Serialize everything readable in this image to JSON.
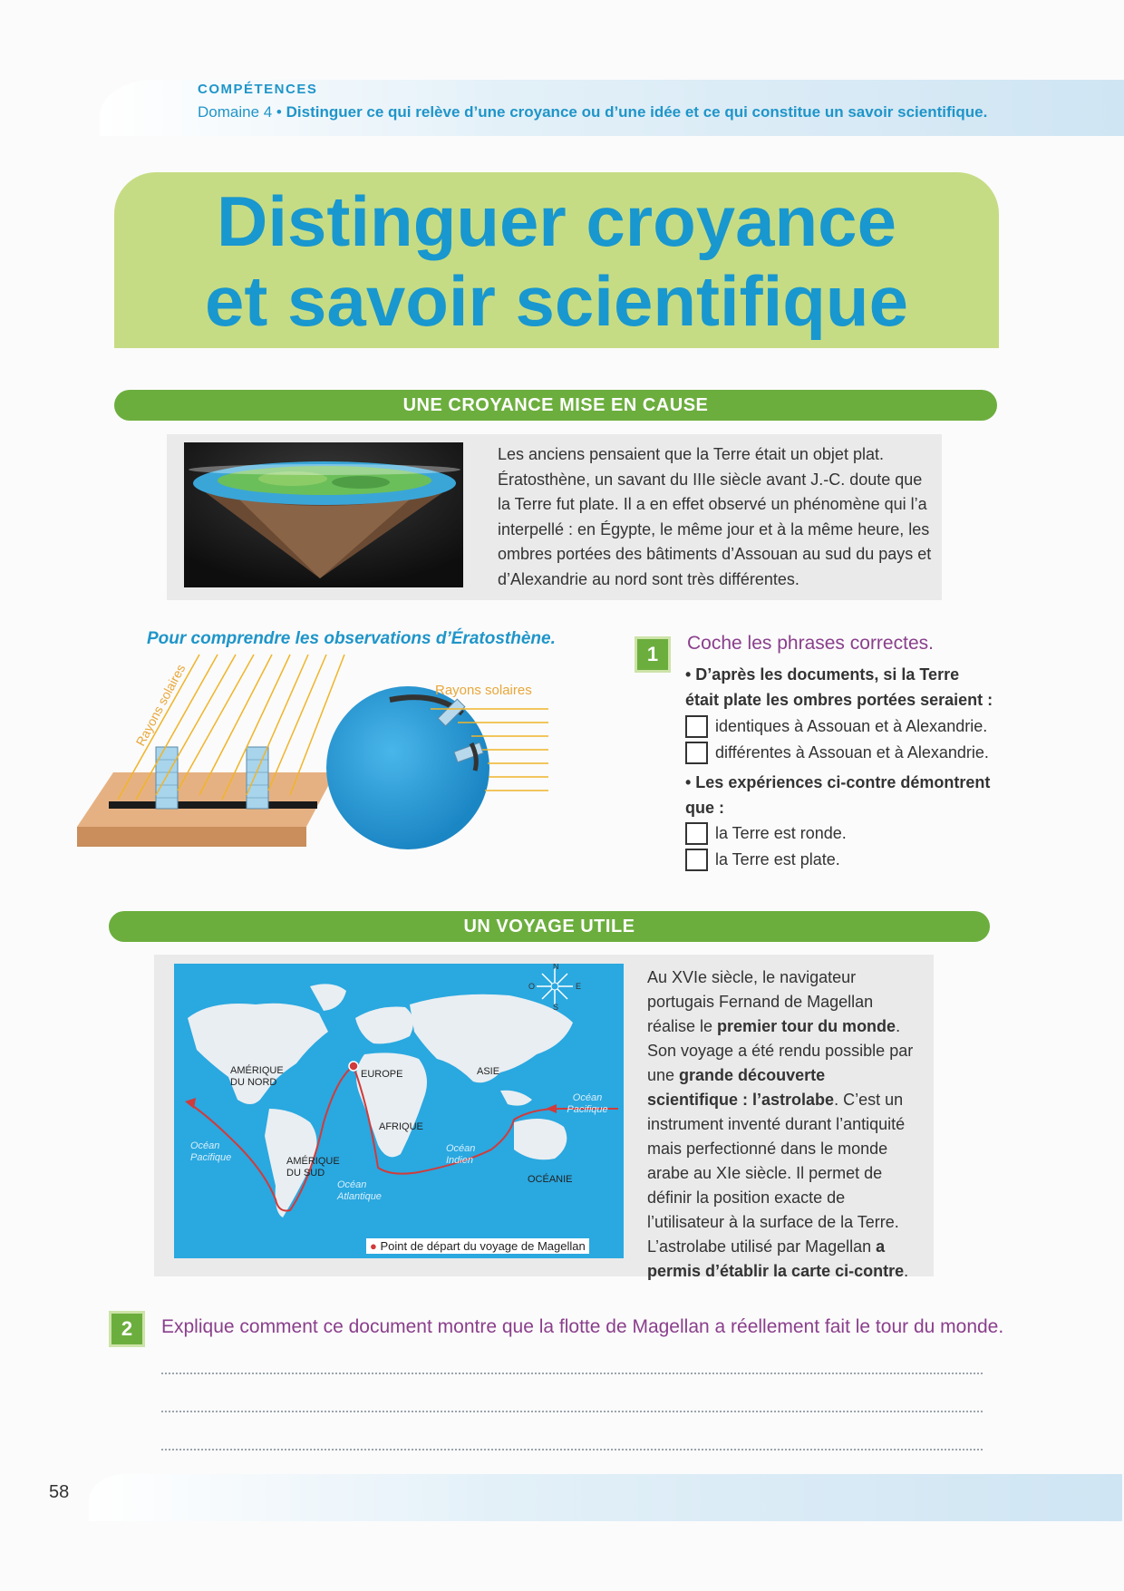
{
  "header": {
    "competences_label": "COMPÉTENCES",
    "domain_label": "Domaine 4 •",
    "domain_text": "Distinguer ce qui relève d’une croyance ou d’une idée et ce qui constitue un savoir scientifique."
  },
  "title": {
    "line1": "Distinguer croyance",
    "line2": "et savoir scientifique"
  },
  "section1": {
    "bar_label": "UNE CROYANCE MISE EN CAUSE",
    "text": "Les anciens pensaient que la Terre était un objet plat. Ératosthène, un savant du IIIe siècle avant J.-C. doute que la Terre fut plate. Il a en effet observé un phénomène qui l’a interpellé : en Égypte, le même jour et à la même heure, les ombres portées des bâtiments d’Assouan au sud du pays et d’Alexandrie au nord sont très différentes.",
    "caption": "Pour comprendre les observations d’Ératosthène.",
    "rays_label_left": "Rayons solaires",
    "rays_label_right": "Rayons solaires"
  },
  "exercise1": {
    "number": "1",
    "title": "Coche les phrases correctes.",
    "q1": "• D’après les documents, si la Terre était plate les ombres portées seraient :",
    "q1_options": [
      "identiques à Assouan et à Alexandrie.",
      "différentes à Assouan et à Alexandrie."
    ],
    "q2": "• Les expériences ci-contre démontrent que :",
    "q2_options": [
      "la Terre est ronde.",
      "la Terre est plate."
    ]
  },
  "section2": {
    "bar_label": "UN VOYAGE UTILE",
    "text_p1": "Au XVIe siècle, le navigateur portugais Fernand de Magellan réalise le ",
    "text_b1": "premier tour du monde",
    "text_p2": ". Son voyage a été rendu possible par une ",
    "text_b2": "grande découverte scientifique : l’astrolabe",
    "text_p3": ". C’est un instrument inventé durant l’antiquité mais perfectionné dans le monde arabe au XIe siècle. Il permet de définir la position exacte de l’utilisateur à la surface de la Terre. L’astrolabe utilisé par Magellan ",
    "text_b3": "a permis d’établir la carte ci-contre",
    "text_p4": ".",
    "map": {
      "north_america": "AMÉRIQUE DU NORD",
      "south_america": "AMÉRIQUE DU SUD",
      "europe": "EUROPE",
      "asia": "ASIE",
      "africa": "AFRIQUE",
      "oceania": "OCÉANIE",
      "pacific_left": "Océan Pacifique",
      "pacific_right": "Océan Pacifique",
      "atlantic": "Océan Atlantique",
      "indian": "Océan Indien",
      "legend": "Point de départ du voyage de Magellan",
      "compass_n": "N",
      "compass_s": "S",
      "compass_e": "E",
      "compass_o": "O"
    }
  },
  "exercise2": {
    "number": "2",
    "title": "Explique comment ce document montre que la flotte de Magellan a réellement fait le tour du monde."
  },
  "footer": {
    "page_number": "58"
  }
}
